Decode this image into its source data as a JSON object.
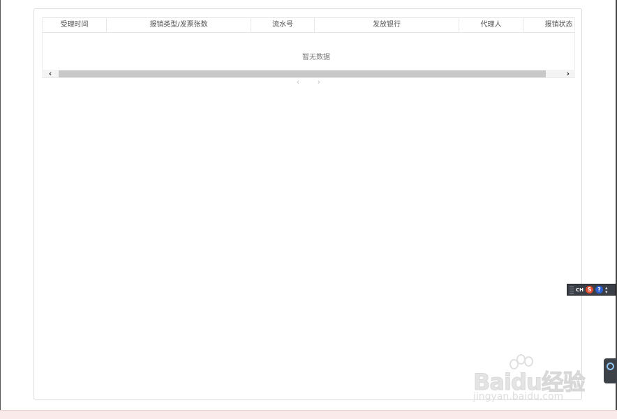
{
  "table": {
    "columns": [
      "受理时间",
      "报销类型/发票张数",
      "流水号",
      "发放银行",
      "代理人",
      "报销状态"
    ],
    "empty_text": "暂无数据"
  },
  "scrollbar": {
    "left_icon": "chevron-left-icon",
    "right_icon": "chevron-right-icon",
    "left_glyph": "‹",
    "right_glyph": "›"
  },
  "pagination": {
    "prev_glyph": "‹",
    "next_glyph": "›"
  },
  "ime": {
    "lang": "CH",
    "logo": "S",
    "help": "?"
  },
  "watermark": {
    "brand": "Baidu经验",
    "url": "jingyan.baidu.com"
  }
}
